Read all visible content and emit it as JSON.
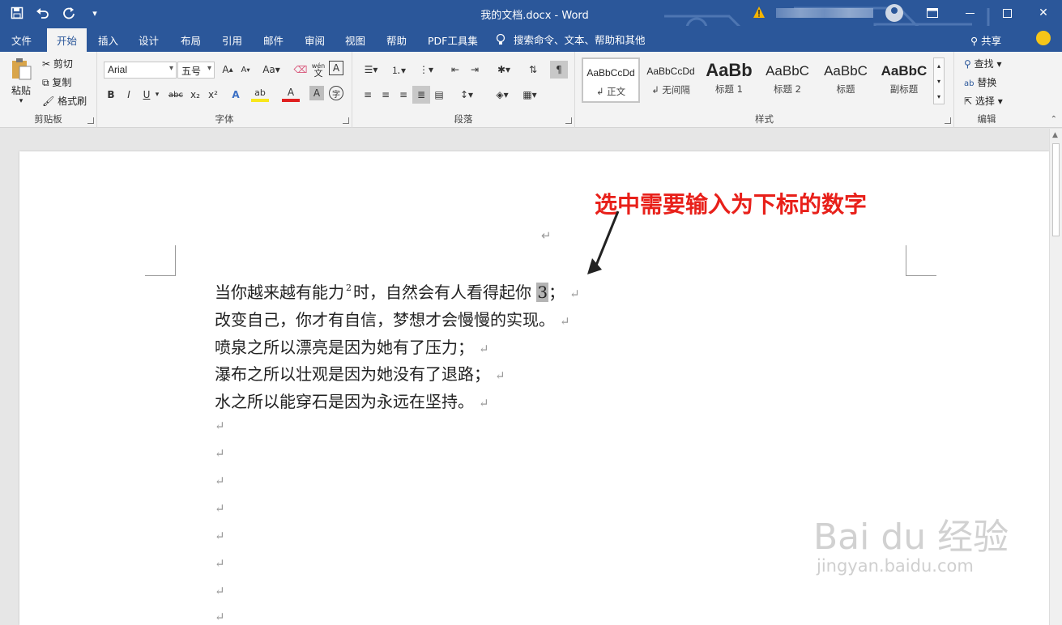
{
  "titlebar": {
    "doc_title": "我的文档.docx  -  Word",
    "qat": {
      "save": "save-icon",
      "undo": "undo-icon",
      "redo": "redo-icon",
      "customize": "customize-qat-icon"
    },
    "window_buttons": {
      "ribbon_options": "ribbon-display-icon",
      "minimize": "minimize-icon",
      "maximize": "maximize-icon",
      "close": "close-icon"
    }
  },
  "tabs": [
    {
      "label": "文件"
    },
    {
      "label": "开始",
      "active": true
    },
    {
      "label": "插入"
    },
    {
      "label": "设计"
    },
    {
      "label": "布局"
    },
    {
      "label": "引用"
    },
    {
      "label": "邮件"
    },
    {
      "label": "审阅"
    },
    {
      "label": "视图"
    },
    {
      "label": "帮助"
    },
    {
      "label": "PDF工具集"
    }
  ],
  "tell_me": "搜索命令、文本、帮助和其他",
  "share_label": "共享",
  "ribbon": {
    "clipboard": {
      "label": "剪贴板",
      "paste": "粘贴",
      "cut": "剪切",
      "copy": "复制",
      "format_painter": "格式刷"
    },
    "font": {
      "label": "字体",
      "font_name": "Arial",
      "font_size": "五号",
      "case_label": "Aa",
      "grow_label": "A",
      "shrink_label": "A",
      "phonetic_top": "wén",
      "phonetic_bottom": "文",
      "border_char": "A",
      "bold": "B",
      "italic": "I",
      "underline": "U",
      "strike": "abc",
      "sub": "x₂",
      "sup": "x²",
      "effects": "A",
      "highlight": "ab",
      "font_color": "A",
      "char_shade": "A",
      "enclose": "字"
    },
    "paragraph": {
      "label": "段落"
    },
    "styles": {
      "label": "样式",
      "items": [
        {
          "sample": "AaBbCcDd",
          "name": "↲ 正文"
        },
        {
          "sample": "AaBbCcDd",
          "name": "↲ 无间隔"
        },
        {
          "sample": "AaBb",
          "name": "标题 1"
        },
        {
          "sample": "AaBbC",
          "name": "标题 2"
        },
        {
          "sample": "AaBbC",
          "name": "标题"
        },
        {
          "sample": "AaBbC",
          "name": "副标题"
        }
      ]
    },
    "editing": {
      "label": "编辑",
      "find": "查找",
      "replace": "替换",
      "select": "选择"
    }
  },
  "document": {
    "annotation": "选中需要输入为下标的数字",
    "pilcrow": "↵",
    "lines": [
      {
        "before": "当你越来越有能力",
        "sup": "2",
        "after": "时，自然会有人看得起你 ",
        "selected": "3",
        "end": "；"
      },
      {
        "text": "改变自己，你才有自信，梦想才会慢慢的实现。"
      },
      {
        "text": "喷泉之所以漂亮是因为她有了压力；"
      },
      {
        "text": "瀑布之所以壮观是因为她没有了退路；"
      },
      {
        "text": "水之所以能穿石是因为永远在坚持。"
      }
    ],
    "watermark": "Bai du 经验",
    "watermark_url": "jingyan.baidu.com"
  },
  "colors": {
    "brand": "#2b579a",
    "annotation": "#e8201a",
    "selection": "#b4b4b4"
  }
}
